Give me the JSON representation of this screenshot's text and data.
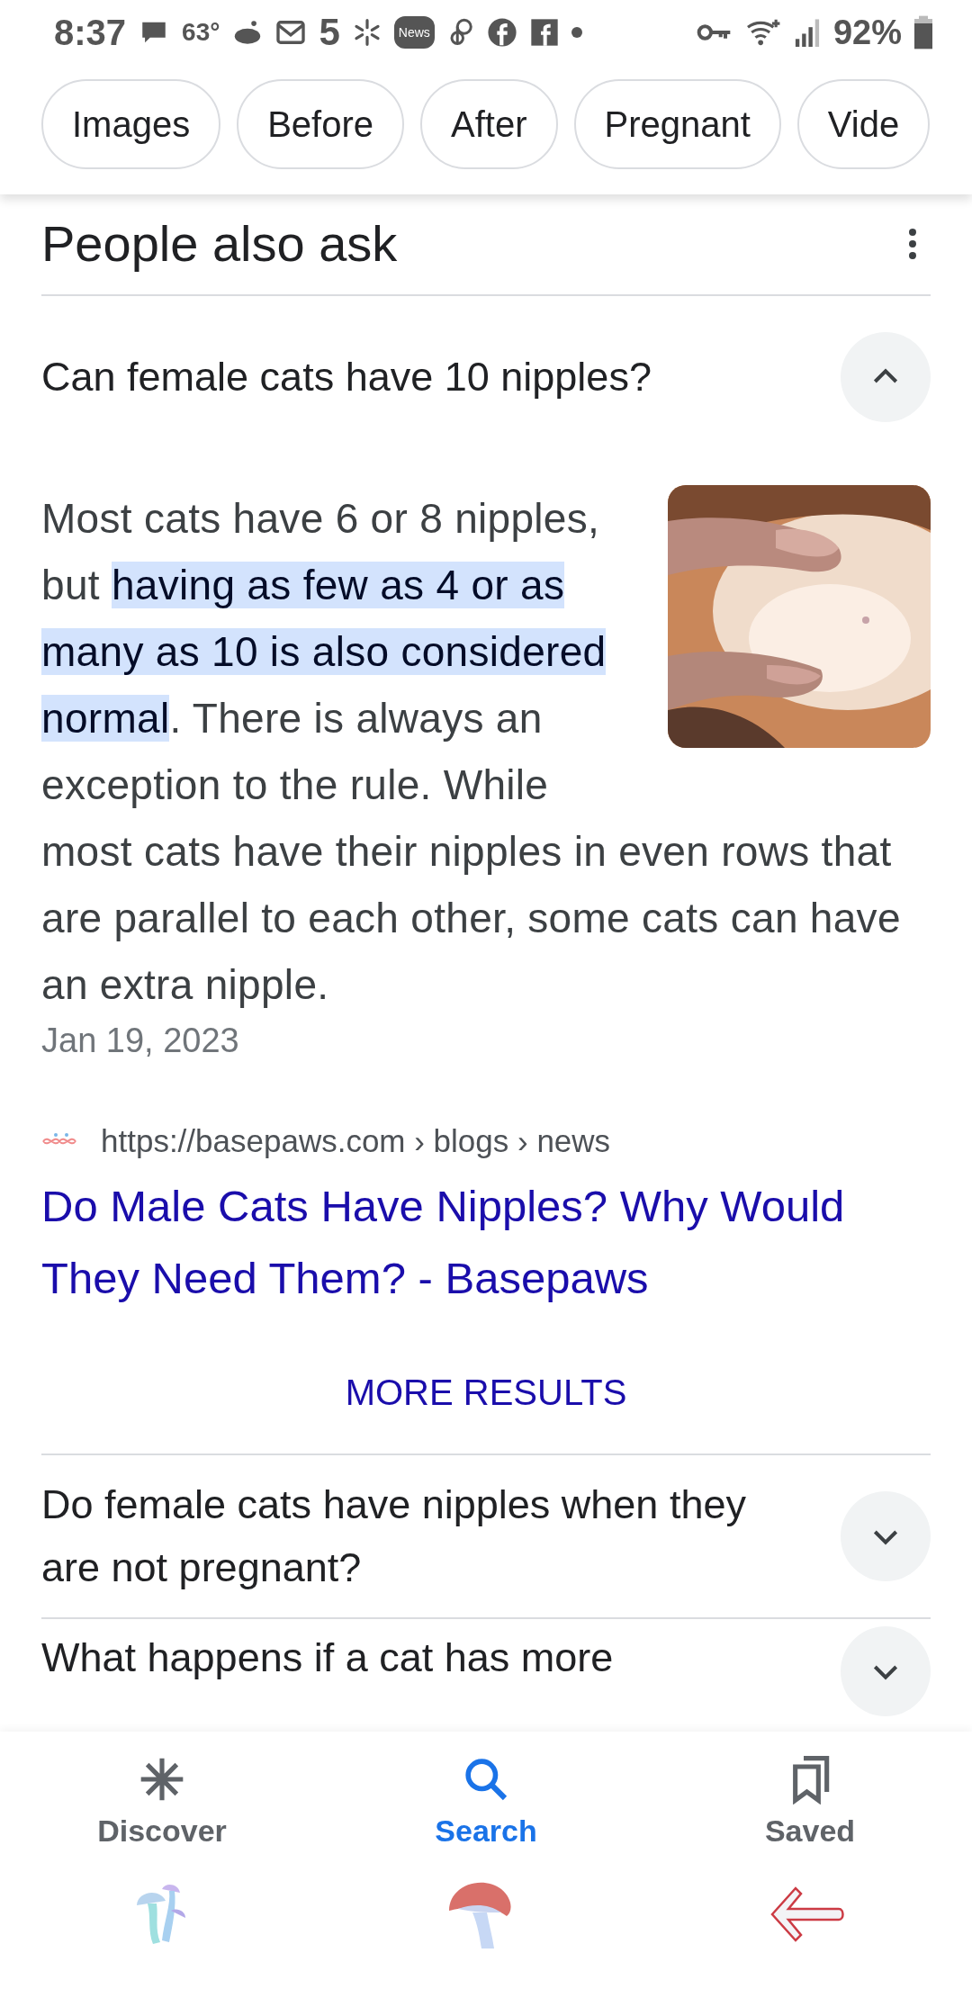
{
  "status_bar": {
    "time": "8:37",
    "temperature": "63°",
    "app_number": "5",
    "news_badge": "News",
    "battery": "92%"
  },
  "chips": [
    {
      "label": "Images"
    },
    {
      "label": "Before"
    },
    {
      "label": "After"
    },
    {
      "label": "Pregnant"
    },
    {
      "label": "Vide"
    }
  ],
  "section": {
    "title": "People also ask"
  },
  "questions": [
    {
      "question": "Can female cats have 10 nipples?",
      "expanded": true,
      "answer": [
        {
          "text": "Most cats have 6 or 8 nipples, but ",
          "highlighted": false
        },
        {
          "text": "having as few as 4 or as many as 10 is also considered normal",
          "highlighted": true
        },
        {
          "text": ". There is always an exception to the rule. While most cats have their nipples in even rows that are parallel to each other, some cats can have an extra nipple.",
          "highlighted": false
        }
      ],
      "date": "Jan 19, 2023",
      "source_url": "https://basepaws.com › blogs › news",
      "link_title": "Do Male Cats Have Nipples? Why Would They Need Them? - Basepaws",
      "more": "MORE RESULTS"
    },
    {
      "question": "Do female cats have nipples when they are not pregnant?",
      "expanded": false
    },
    {
      "question": "What happens if a cat has more",
      "expanded": false
    }
  ],
  "bottom_nav": [
    {
      "label": "Discover",
      "selected": false
    },
    {
      "label": "Search",
      "selected": true
    },
    {
      "label": "Saved",
      "selected": false
    }
  ]
}
